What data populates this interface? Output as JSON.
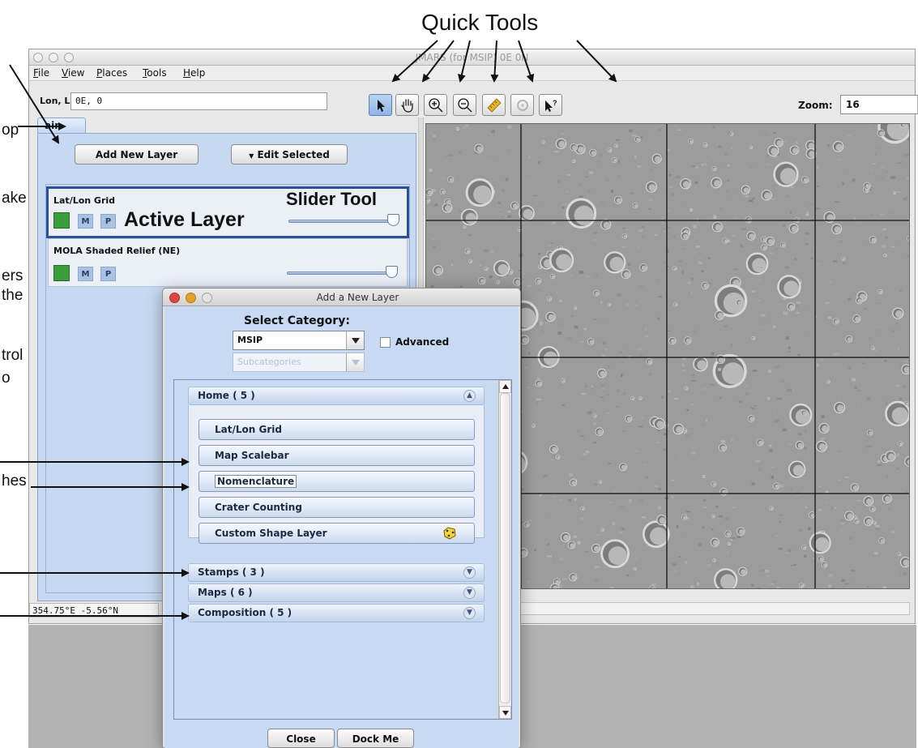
{
  "annotations": {
    "quick_tools": "Quick Tools",
    "left_fragments": [
      "op",
      "ake",
      "ers",
      "the",
      "trol",
      "o",
      "hes"
    ]
  },
  "window": {
    "title": "JMARS (for MSIP) 0E 0N",
    "menu": [
      "File",
      "View",
      "Places",
      "Tools",
      "Help"
    ]
  },
  "toolbar": {
    "lonlat_label": "Lon, Lat",
    "lonlat_value": "0E, 0",
    "zoom_label": "Zoom:",
    "zoom_value": "16",
    "tools": [
      "select-arrow-icon",
      "pan-hand-icon",
      "zoom-in-icon",
      "zoom-out-icon",
      "ruler-icon",
      "gear-disabled-icon",
      "investigate-icon"
    ]
  },
  "left_panel": {
    "tab": "Main",
    "tab_visible_text": "ain",
    "add_button": "Add New Layer",
    "edit_button": "Edit Selected",
    "edit_glyph": "▼",
    "layers": [
      {
        "name": "Lat/Lon Grid",
        "m": "M",
        "p": "P",
        "color": "#3a9d3a",
        "opacity": 0.95,
        "active": true
      },
      {
        "name": "MOLA Shaded Relief (NE)",
        "m": "M",
        "p": "P",
        "color": "#3a9d3a",
        "opacity": 0.95,
        "active": false
      }
    ],
    "active_layer_label": "Active Layer",
    "slider_tool_label": "Slider Tool"
  },
  "status": {
    "coords": "354.75°E  -5.56°N"
  },
  "dialog": {
    "title": "Add a New Layer",
    "select_category": "Select Category:",
    "category_value": "MSIP",
    "subcategory_placeholder": "Subcategories",
    "advanced_label": "Advanced",
    "sections": [
      {
        "label": "Home ( 5 )",
        "expanded": true
      },
      {
        "label": "Stamps ( 3 )",
        "expanded": false
      },
      {
        "label": "Maps ( 6 )",
        "expanded": false
      },
      {
        "label": "Composition ( 5 )",
        "expanded": false
      }
    ],
    "home_items": [
      "Lat/Lon Grid",
      "Map Scalebar",
      "Nomenclature",
      "Crater Counting",
      "Custom Shape Layer"
    ],
    "close_button": "Close",
    "dock_button": "Dock Me"
  },
  "colors": {
    "panel_blue": "#c7d9f2",
    "active_border": "#2b4f9b",
    "layer_green": "#3a9d3a"
  }
}
